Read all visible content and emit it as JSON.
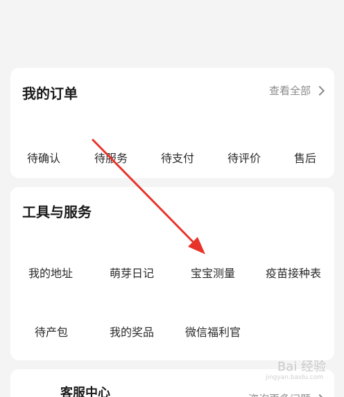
{
  "orders": {
    "title": "我的订单",
    "view_all": "查看全部",
    "items": [
      "待确认",
      "待服务",
      "待支付",
      "待评价",
      "售后"
    ]
  },
  "tools": {
    "title": "工具与服务",
    "items": [
      "我的地址",
      "萌芽日记",
      "宝宝测量",
      "疫苗接种表",
      "待产包",
      "我的奖品",
      "微信福利官"
    ]
  },
  "service": {
    "title": "客服中心",
    "link": "咨询更多问题"
  },
  "watermark": {
    "logo_text": "Bai 经验",
    "sub": "jingyan.baidu.com"
  },
  "colors": {
    "annotation_arrow": "#e8332a",
    "background": "#f4f4f5",
    "card": "#ffffff"
  }
}
